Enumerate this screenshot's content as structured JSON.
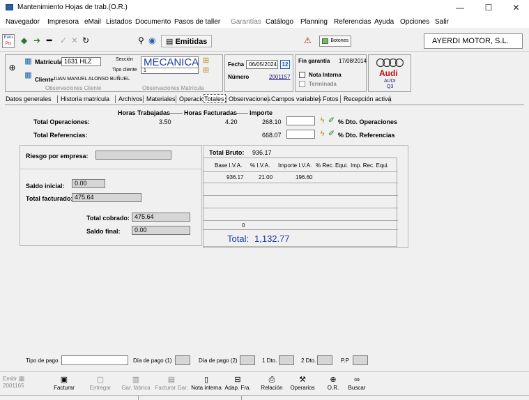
{
  "window": {
    "title": "Mantenimiento Hojas de trab.(O.R.)",
    "min_label": "—",
    "max_label": "☐",
    "close_label": "✕"
  },
  "menu": [
    {
      "label": "Navegador"
    },
    {
      "label": "Impresora"
    },
    {
      "label": "eMail"
    },
    {
      "label": "Listados"
    },
    {
      "label": "Documento"
    },
    {
      "label": "Pasos de taller"
    },
    {
      "label": "Garantías",
      "disabled": true
    },
    {
      "label": "Catálogo"
    },
    {
      "label": "Planning"
    },
    {
      "label": "Referencias"
    },
    {
      "label": "Ayuda"
    },
    {
      "label": "Opciones"
    },
    {
      "label": "Salir"
    }
  ],
  "toolbar": {
    "euro_label": "Euro",
    "pts_label": "Pts",
    "emitidas_label": "Emitidas",
    "botones_label": "Botones",
    "company": "AYERDI MOTOR, S.L."
  },
  "header": {
    "matricula_label": "Matrícula",
    "matricula_value": "1631 HLZ",
    "seccion_label": "Sección",
    "seccion_value": "MECANICA",
    "tipo_cliente_label": "Tipo cliente",
    "tipo_cliente_value": "1",
    "cliente_label": "Cliente",
    "cliente_value": "JUAN MANUEL ALONSO BUÑUEL",
    "obs_cliente": "Observaciones Cliente",
    "obs_matricula": "Observaciones Matrícula",
    "fecha_label": "Fecha",
    "fecha_value": "06/05/2024",
    "cal_label": "12",
    "numero_label": "Número",
    "numero_value": "2001157",
    "fin_garantia_label": "Fin garantía",
    "fin_garantia_value": "17/08/2014",
    "nota_interna_label": "Nota Interna",
    "terminada_label": "Terminada",
    "brand": "Audi",
    "brand_model_1": "AUDI",
    "brand_model_2": "Q3"
  },
  "tabs": [
    {
      "label": "Datos generales"
    },
    {
      "label": "Historia matrícula"
    },
    {
      "label": "Archivos"
    },
    {
      "label": "Materiales"
    },
    {
      "label": "Operaciones"
    },
    {
      "label": "Totales",
      "selected": true
    },
    {
      "label": "Observaciones"
    },
    {
      "label": "Campos variables"
    },
    {
      "label": "Fotos"
    },
    {
      "label": "Recepción activa"
    }
  ],
  "totales": {
    "col_horas_trab": "Horas Trabajadas",
    "col_horas_fact": "Horas Facturadas",
    "col_importe": "Importe",
    "op_label": "Total Operaciones:",
    "op_horas_trab": "3.50",
    "op_horas_fact": "4.20",
    "op_importe": "268.10",
    "op_dto_label": "% Dto. Operaciones",
    "ref_label": "Total Referencias:",
    "ref_importe": "668.07",
    "ref_dto_label": "% Dto. Referencias"
  },
  "left": {
    "riesgo_label": "Riesgo por empresa:",
    "saldo_inicial_label": "Saldo inicial:",
    "saldo_inicial_value": "0.00",
    "total_facturado_label": "Total facturado:",
    "total_facturado_value": "475.64",
    "total_cobrado_label": "Total cobrado:",
    "total_cobrado_value": "475.64",
    "saldo_final_label": "Saldo final:",
    "saldo_final_value": "0.00"
  },
  "iva": {
    "total_bruto_label": "Total Bruto:",
    "total_bruto_value": "936.17",
    "headers": [
      "Base I.V.A.",
      "% I.V.A.",
      "Importe I.V.A.",
      "% Rec. Equi.",
      "Imp. Rec. Equi."
    ],
    "row1": [
      "936.17",
      "21.00",
      "196.60"
    ],
    "zero": "0",
    "total_label": "Total:",
    "total_value": "1,132.77"
  },
  "pago": {
    "tipo_label": "Tipo de pago",
    "dia1_label": "Día de pago (1)",
    "dia2_label": "Día de pago (2)",
    "dto1_label": "1 Dto.",
    "dto2_label": "2 Dto.",
    "pp_label": "P.P"
  },
  "bottom": {
    "emitir_label": "Emitir",
    "emitir_num": "2001165",
    "buttons": [
      {
        "label": "Facturar",
        "disabled": false
      },
      {
        "label": "Entregar",
        "disabled": true
      },
      {
        "label": "Gar. fábrica",
        "disabled": true
      },
      {
        "label": "Facturar Gar.",
        "disabled": true
      },
      {
        "label": "Nota interna",
        "disabled": false
      },
      {
        "label": "Adap. Fra.",
        "disabled": false
      },
      {
        "label": "Relación",
        "disabled": false
      },
      {
        "label": "Operarios",
        "disabled": false
      },
      {
        "label": "O.R.",
        "disabled": false
      },
      {
        "label": "Buscar",
        "disabled": false
      }
    ]
  }
}
